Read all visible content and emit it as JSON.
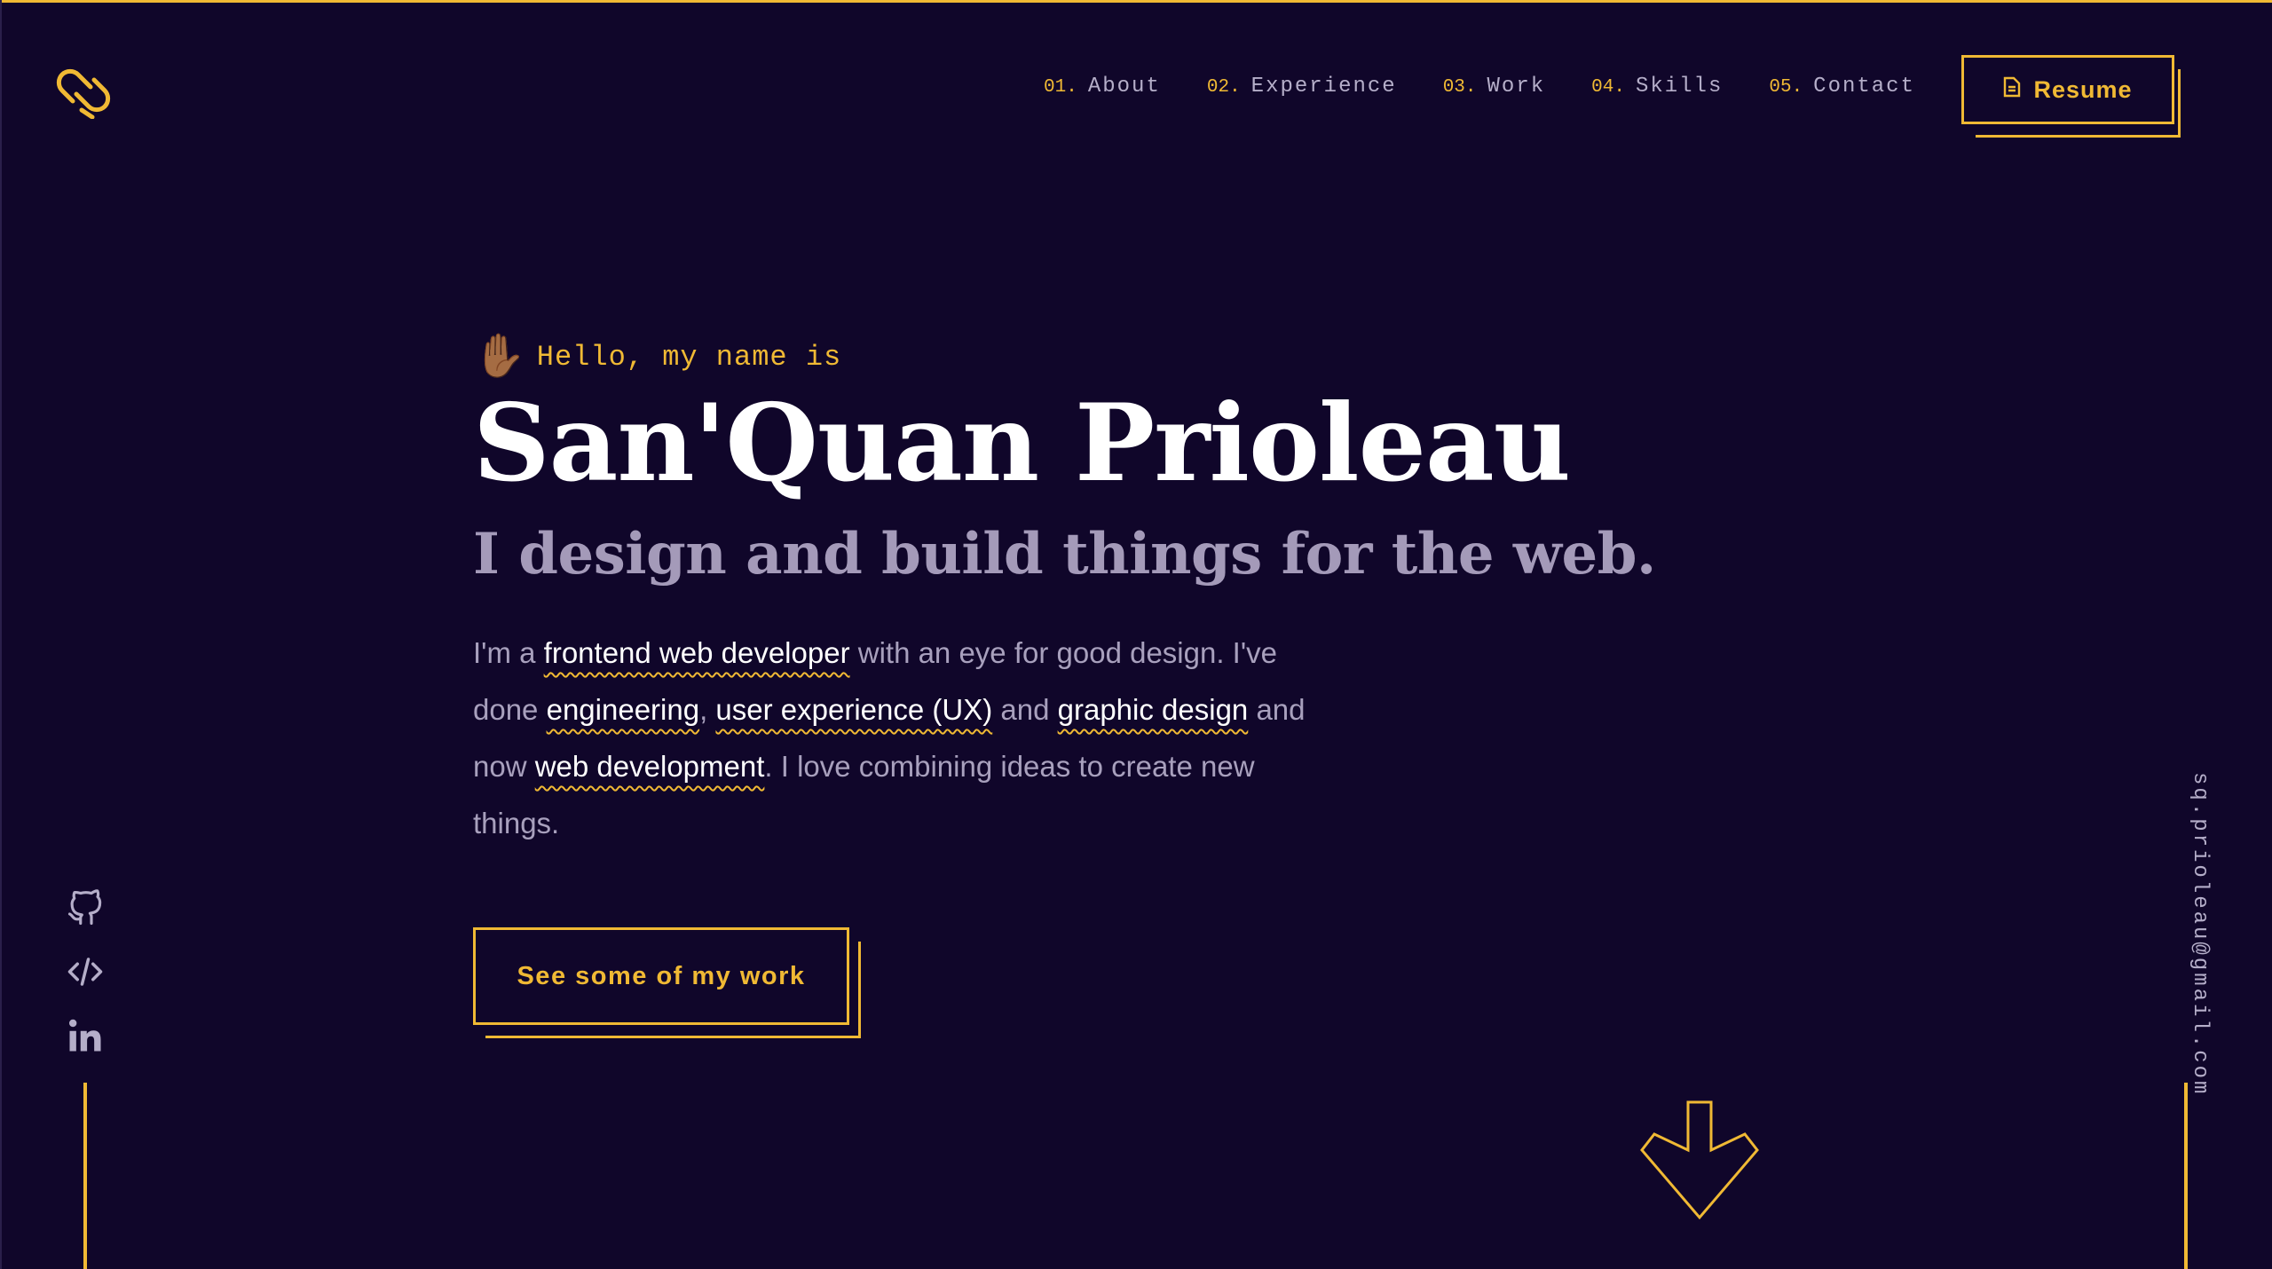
{
  "colors": {
    "background": "#10062a",
    "accent": "#f0b934",
    "text": "#ffffff",
    "muted": "#a49ab9"
  },
  "header": {
    "logo_icon": "logo-mark-icon",
    "nav": [
      {
        "num": "01.",
        "label": "About"
      },
      {
        "num": "02.",
        "label": "Experience"
      },
      {
        "num": "03.",
        "label": "Work"
      },
      {
        "num": "04.",
        "label": "Skills"
      },
      {
        "num": "05.",
        "label": "Contact"
      }
    ],
    "resume_label": "Resume",
    "resume_icon": "document-icon"
  },
  "hero": {
    "wave_emoji": "✋🏾",
    "greeting": "Hello, my name is",
    "name": "San'Quan Prioleau",
    "tagline": "I design and build things for the web.",
    "intro": {
      "p1": "I'm a ",
      "h1": "frontend web developer",
      "p2": " with an eye for good design. I've done ",
      "h2": "engineering",
      "p3": ", ",
      "h3": "user experience (UX)",
      "p4": " and ",
      "h4": "graphic design",
      "p5": " and now ",
      "h5": "web development",
      "p6": ". I love combining ideas to create new things."
    },
    "cta_label": "See some of my work"
  },
  "socials": [
    "github-icon",
    "code-icon",
    "linkedin-icon"
  ],
  "email": "sq.prioleau@gmail.com",
  "scroll_icon": "arrow-down-icon"
}
